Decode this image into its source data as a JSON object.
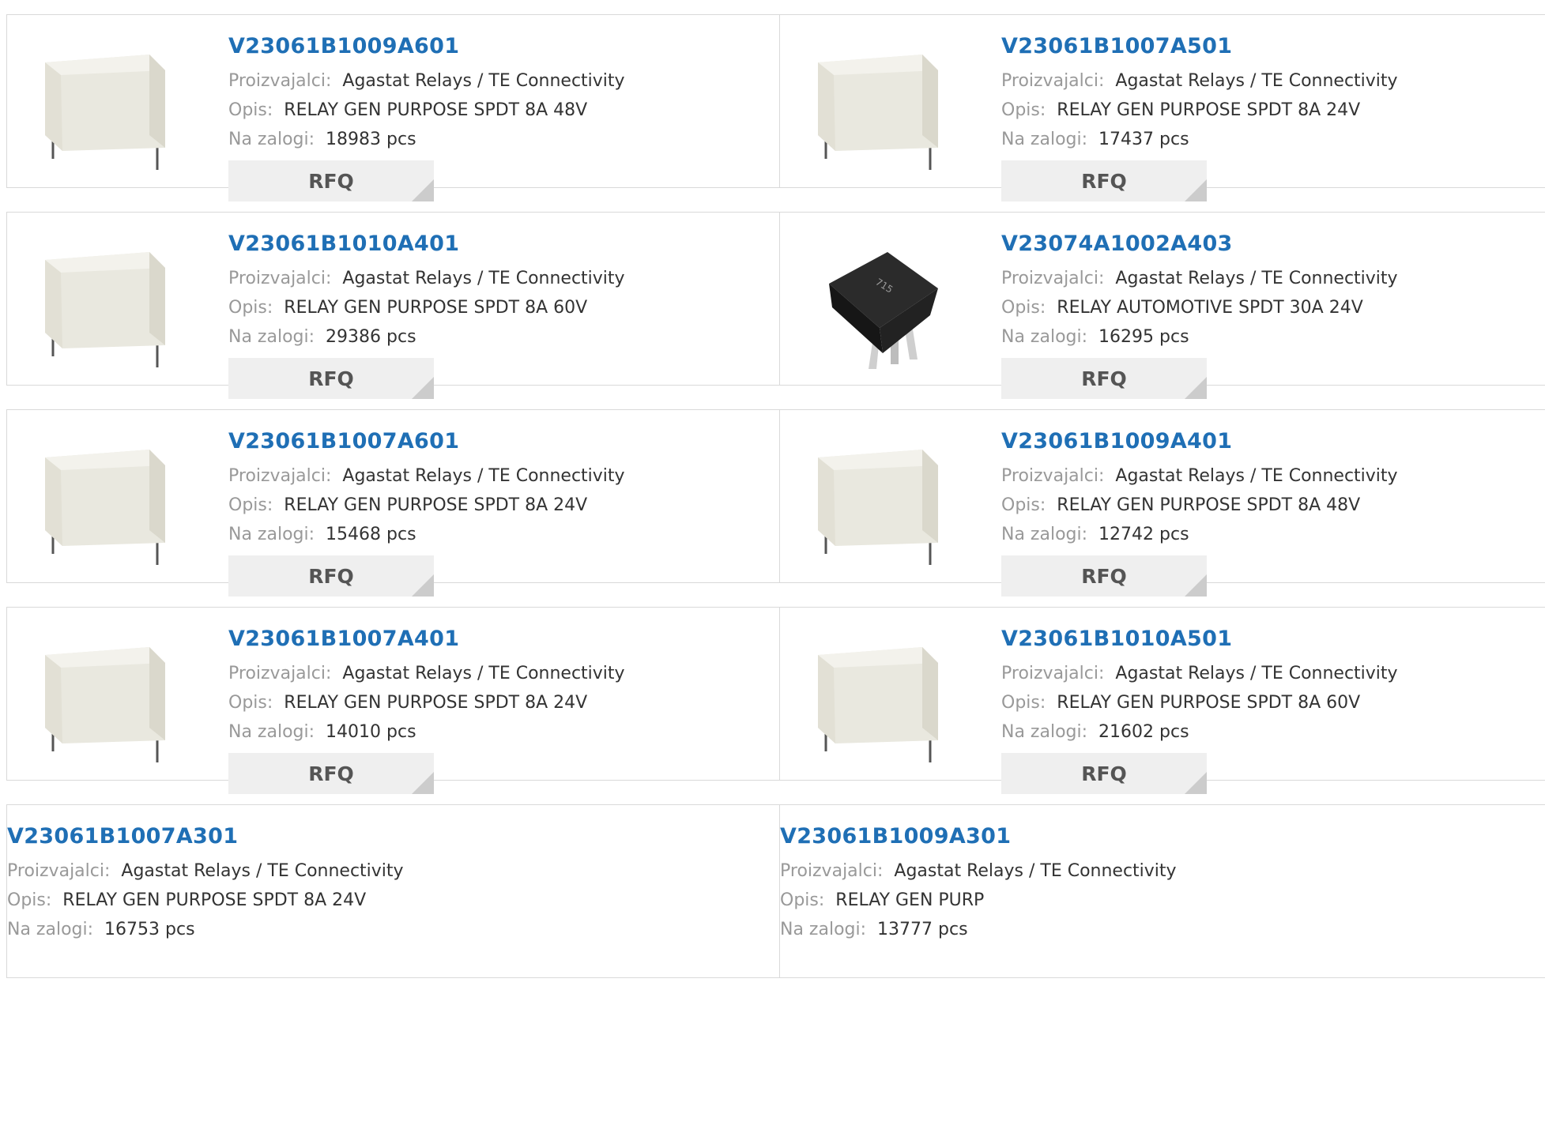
{
  "labels": {
    "manufacturer": "Proizvajalci:",
    "description": "Opis:",
    "stock": "Na zalogi:",
    "rfq": "RFQ"
  },
  "colors": {
    "link": "#1f6fb5",
    "label": "#999999",
    "button_bg": "#efefef"
  },
  "products": [
    {
      "part": "V23061B1009A601",
      "manufacturer": "Agastat Relays / TE Connectivity",
      "description": "RELAY GEN PURPOSE SPDT 8A 48V",
      "stock": "18983 pcs",
      "image": "white-relay"
    },
    {
      "part": "V23061B1007A501",
      "manufacturer": "Agastat Relays / TE Connectivity",
      "description": "RELAY GEN PURPOSE SPDT 8A 24V",
      "stock": "17437 pcs",
      "image": "white-relay"
    },
    {
      "part": "V23061B1010A401",
      "manufacturer": "Agastat Relays / TE Connectivity",
      "description": "RELAY GEN PURPOSE SPDT 8A 60V",
      "stock": "29386 pcs",
      "image": "white-relay"
    },
    {
      "part": "V23074A1002A403",
      "manufacturer": "Agastat Relays / TE Connectivity",
      "description": "RELAY AUTOMOTIVE SPDT 30A 24V",
      "stock": "16295 pcs",
      "image": "black-automotive-relay"
    },
    {
      "part": "V23061B1007A601",
      "manufacturer": "Agastat Relays / TE Connectivity",
      "description": "RELAY GEN PURPOSE SPDT 8A 24V",
      "stock": "15468 pcs",
      "image": "white-relay"
    },
    {
      "part": "V23061B1009A401",
      "manufacturer": "Agastat Relays / TE Connectivity",
      "description": "RELAY GEN PURPOSE SPDT 8A 48V",
      "stock": "12742 pcs",
      "image": "white-relay"
    },
    {
      "part": "V23061B1007A401",
      "manufacturer": "Agastat Relays / TE Connectivity",
      "description": "RELAY GEN PURPOSE SPDT 8A 24V",
      "stock": "14010 pcs",
      "image": "white-relay"
    },
    {
      "part": "V23061B1010A501",
      "manufacturer": "Agastat Relays / TE Connectivity",
      "description": "RELAY GEN PURPOSE SPDT 8A 60V",
      "stock": "21602 pcs",
      "image": "white-relay"
    },
    {
      "part": "V23061B1007A301",
      "manufacturer": "Agastat Relays / TE Connectivity",
      "description": "RELAY GEN PURPOSE SPDT 8A 24V",
      "stock": "16753 pcs",
      "image": ""
    },
    {
      "part": "V23061B1009A301",
      "manufacturer": "Agastat Relays / TE Connectivity",
      "description": "RELAY GEN PURP",
      "stock": "13777 pcs",
      "image": ""
    }
  ]
}
